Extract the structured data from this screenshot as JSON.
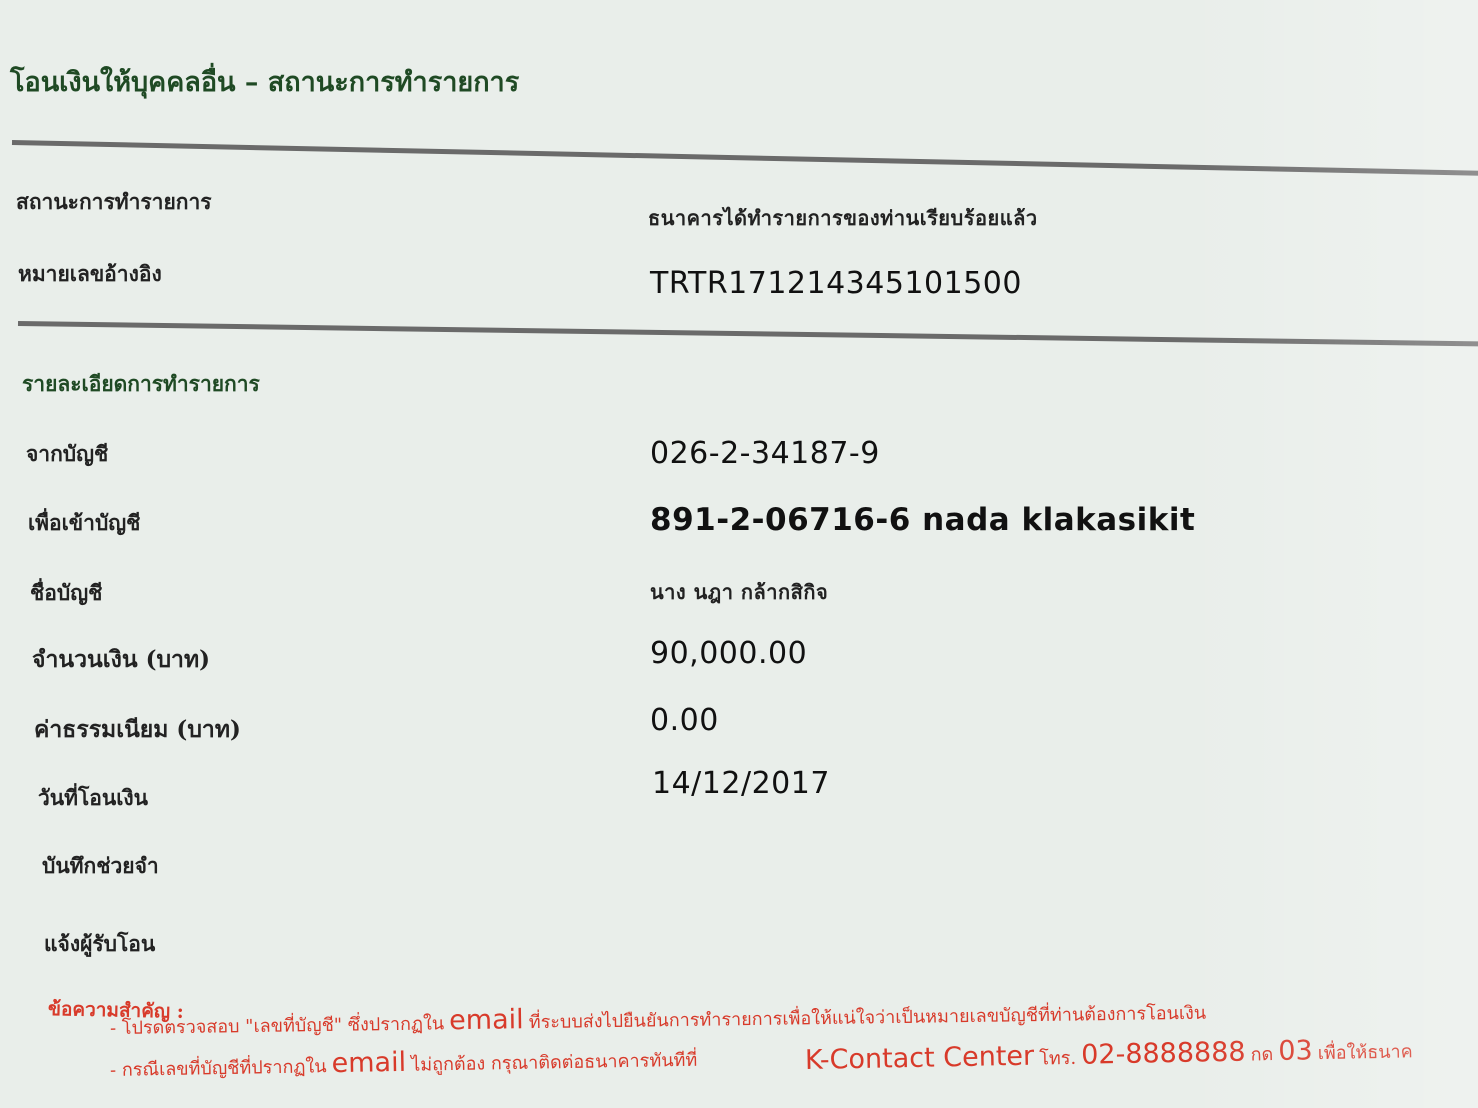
{
  "page": {
    "title": "โอนเงินให้บุคคลอื่น  –  สถานะการทำรายการ"
  },
  "status_section": {
    "status_label": "สถานะการทำรายการ",
    "status_value": "ธนาคารได้ทำรายการของท่านเรียบร้อยแล้ว",
    "reference_label": "หมายเลขอ้างอิง",
    "reference_value": "TRTR171214345101500"
  },
  "details": {
    "heading": "รายละเอียดการทำรายการ",
    "from_account_label": "จากบัญชี",
    "from_account_value": "026-2-34187-9",
    "to_account_label": "เพื่อเข้าบัญชี",
    "to_account_value": "891-2-06716-6 nada klakasikit",
    "account_name_label": "ชื่อบัญชี",
    "account_name_value": "นาง นฎา กล้ากสิกิจ",
    "amount_label": "จำนวนเงิน (บาท)",
    "amount_value": "90,000.00",
    "fee_label": "ค่าธรรมเนียม (บาท)",
    "fee_value": "0.00",
    "date_label": "วันที่โอนเงิน",
    "date_value": "14/12/2017",
    "memo_label": "บันทึกช่วยจำ",
    "notify_label": "แจ้งผู้รับโอน"
  },
  "notice": {
    "title": "ข้อความสำคัญ :",
    "line1_a": "- โปรดตรวจสอบ \"เลขที่บัญชี\" ซึ่งปรากฏใน",
    "line1_b": "email",
    "line1_c": "ที่ระบบส่งไปยืนยันการทำรายการเพื่อให้แน่ใจว่าเป็นหมายเลขบัญชีที่ท่านต้องการโอนเงิน",
    "line2_a": "K-Contact Center",
    "line2_b": "โทร.",
    "line2_c": "02-8888888",
    "line2_d": "กด",
    "line2_e": "03",
    "line2_f": "เพื่อให้ธนาค",
    "line3_a": "- กรณีเลขที่บัญชีที่ปรากฏใน",
    "line3_b": "email",
    "line3_c": "ไม่ถูกต้อง กรุณาติดต่อธนาคารทันทีที่"
  }
}
